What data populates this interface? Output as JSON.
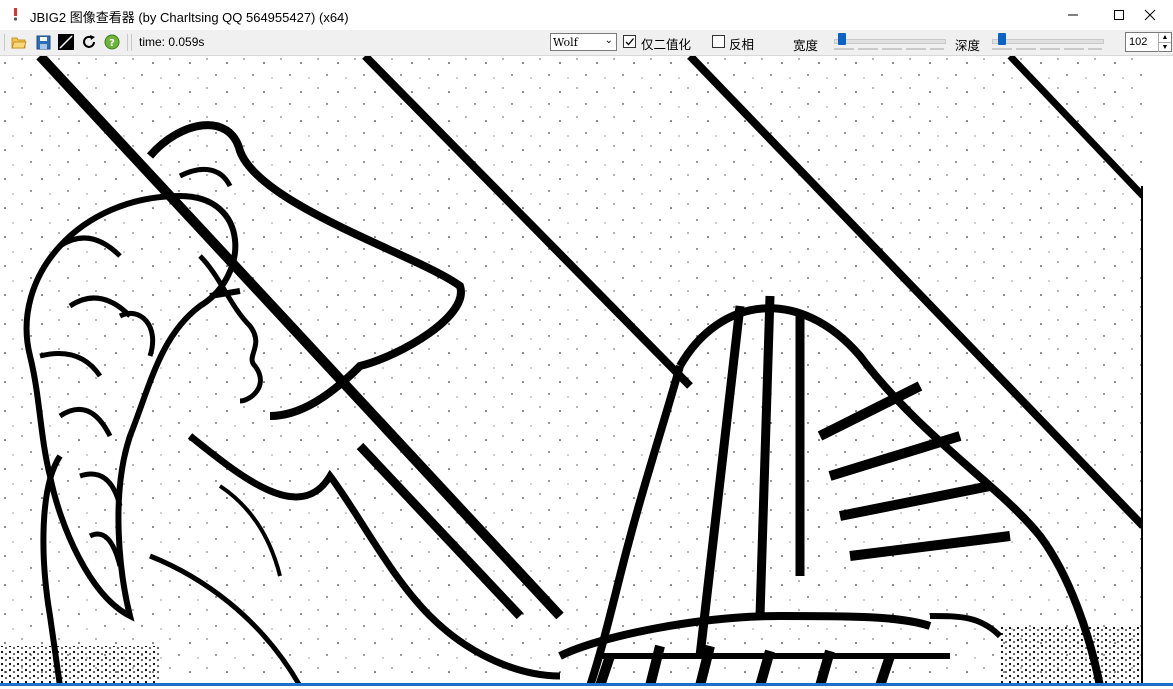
{
  "window": {
    "title": "JBIG2 图像查看器 (by Charltsing QQ 564955427)   (x64)"
  },
  "toolbar": {
    "icons": [
      "open-folder-icon",
      "save-icon",
      "invert-icon",
      "refresh-icon",
      "help-icon"
    ],
    "time_label": "time: 0.059s",
    "algorithm": "Wolf",
    "binarize_only_label": "仅二值化",
    "binarize_only_checked": true,
    "invert_label": "反相",
    "invert_checked": false,
    "width_label": "宽度",
    "depth_label": "深度",
    "threshold_value": "102",
    "accent_color": "#0a62c6"
  },
  "image": {
    "description_icon": "binarized-line-art-image"
  }
}
